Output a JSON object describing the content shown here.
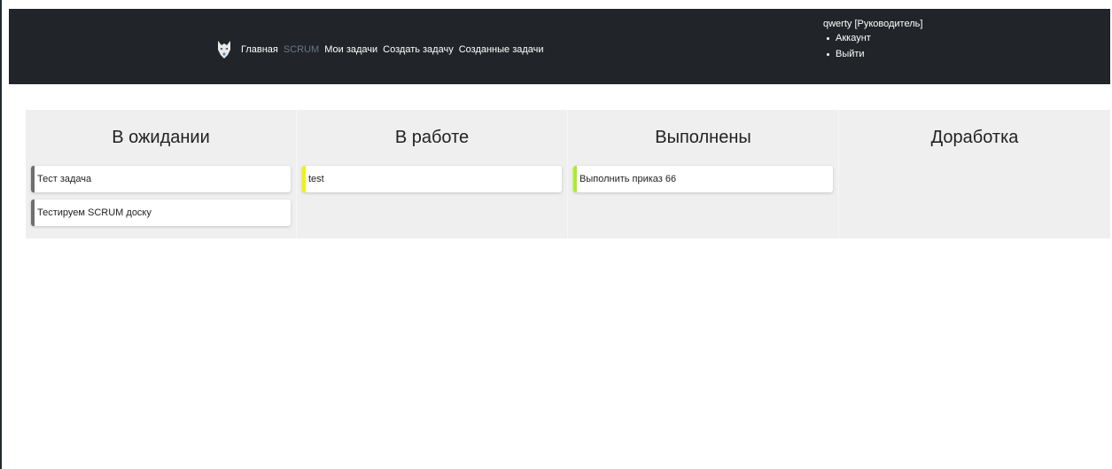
{
  "nav": {
    "links": [
      {
        "label": "Главная"
      },
      {
        "label": "SCRUM"
      },
      {
        "label": "Мои задачи"
      },
      {
        "label": "Создать задачу"
      },
      {
        "label": "Созданные задачи"
      }
    ]
  },
  "user": {
    "name": "qwerty [Руководитель]",
    "menu": [
      "Аккаунт",
      "Выйти"
    ]
  },
  "board": {
    "columns": [
      {
        "title": "В ожидании",
        "cards": [
          {
            "text": "Тест задача",
            "color": "#6e6e6e"
          },
          {
            "text": "Тестируем SCRUM доску",
            "color": "#6e6e6e"
          }
        ]
      },
      {
        "title": "В работе",
        "cards": [
          {
            "text": "test",
            "color": "#f2f20a"
          }
        ]
      },
      {
        "title": "Выполнены",
        "cards": [
          {
            "text": "Выполнить приказ 66",
            "color": "#a8f01e"
          }
        ]
      },
      {
        "title": "Доработка",
        "cards": []
      }
    ]
  }
}
